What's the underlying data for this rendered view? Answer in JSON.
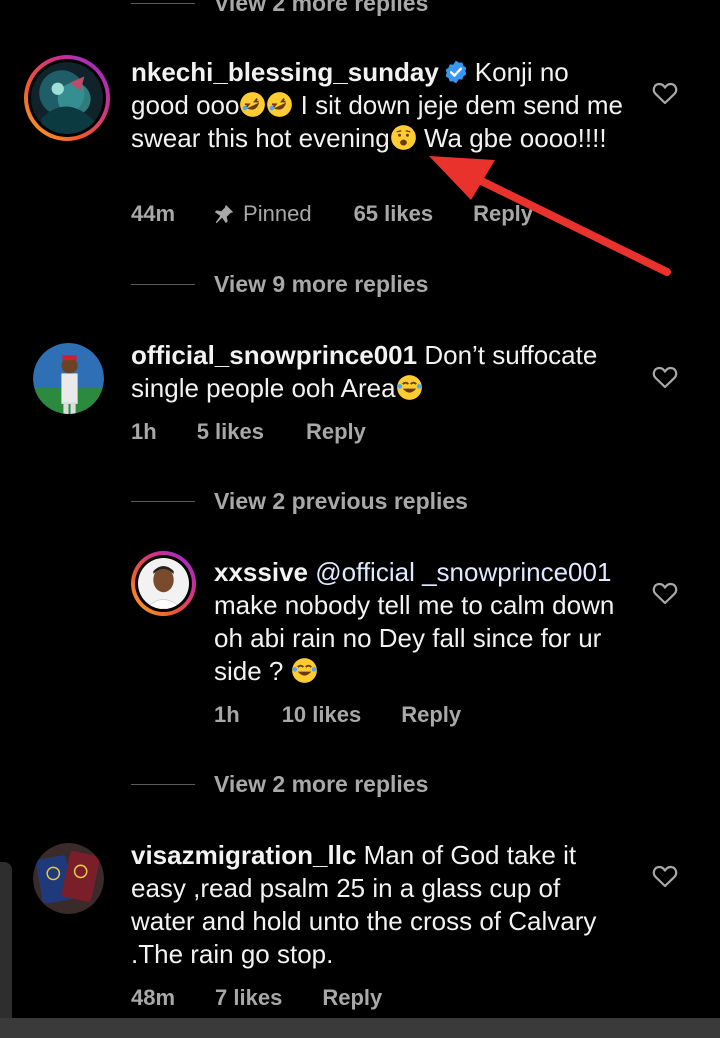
{
  "top_view_more": "View 2 more replies",
  "comments": [
    {
      "username": "nkechi_blessing_sunday",
      "verified": true,
      "text_parts": [
        "Konji no good ooo",
        " I sit down jeje dem send me swear this hot evening",
        " Wa gbe oooo!!!!"
      ],
      "time": "44m",
      "pinned_label": "Pinned",
      "likes": "65 likes",
      "reply": "Reply",
      "view_replies": "View 9 more replies"
    },
    {
      "username": "official_snowprince001",
      "text": " Don’t suffocate single people ooh Area",
      "time": "1h",
      "likes": "5 likes",
      "reply": "Reply",
      "view_replies": "View 2 previous replies"
    },
    {
      "username": "xxssive",
      "mention": "@official _snowprince001",
      "text": " make nobody tell me to calm down oh abi rain no Dey fall since for ur side ? ",
      "time": "1h",
      "likes": "10 likes",
      "reply": "Reply",
      "view_replies": "View 2 more replies"
    },
    {
      "username": "visazmigration_llc",
      "text": " Man of God take it easy ,read psalm 25 in a glass cup of water and hold unto the cross of Calvary .The rain go stop.",
      "time": "48m",
      "likes": "7 likes",
      "reply": "Reply"
    }
  ],
  "colors": {
    "background": "#000000",
    "secondary_text": "#a8a8a8",
    "verified_badge": "#3897f0",
    "annotation_arrow": "#e8322b"
  },
  "icons": [
    "heart-icon",
    "verified-badge-icon",
    "pin-icon",
    "rofl-emoji",
    "tired-emoji",
    "joy-emoji",
    "red-arrow-annotation"
  ]
}
